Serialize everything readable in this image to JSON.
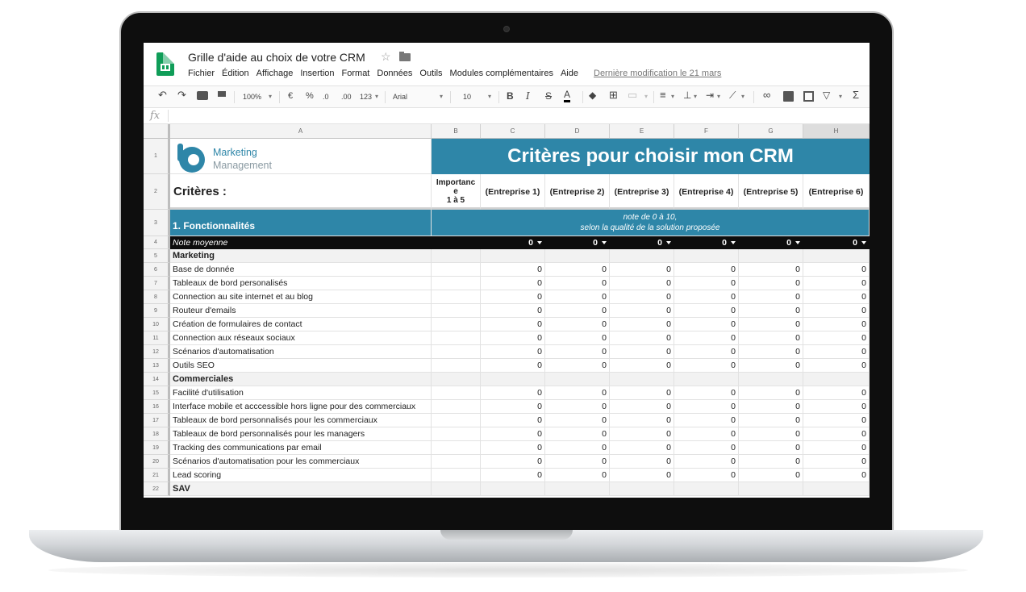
{
  "app": {
    "doc_title": "Grille d'aide au choix de votre CRM",
    "menu": [
      "Fichier",
      "Édition",
      "Affichage",
      "Insertion",
      "Format",
      "Données",
      "Outils",
      "Modules complémentaires",
      "Aide"
    ],
    "last_modified": "Dernière modification le 21 mars"
  },
  "toolbar": {
    "zoom": "100%",
    "currency": "€",
    "percent": "%",
    "dec_less": ".0",
    "dec_more": ".00",
    "format_123": "123",
    "font": "Arial",
    "font_size": "10",
    "bold": "B",
    "italic": "I",
    "strike": "S",
    "text_color": "A",
    "sum": "Σ"
  },
  "formula_bar": {
    "fx": "fx",
    "value": ""
  },
  "columns": [
    "A",
    "B",
    "C",
    "D",
    "E",
    "F",
    "G",
    "H"
  ],
  "sheet": {
    "logo_line1": "Marketing",
    "logo_line2": "Management",
    "banner_title": "Critères pour choisir mon CRM",
    "criteria_label": "Critères :",
    "importance_line1": "Importanc",
    "importance_line2": "e",
    "importance_line3": "1 à 5",
    "companies": [
      "(Entreprise 1)",
      "(Entreprise 2)",
      "(Entreprise 3)",
      "(Entreprise 4)",
      "(Entreprise 5)",
      "(Entreprise 6)"
    ],
    "section1_title": "1. Fonctionnalités",
    "note_line1": "note de 0 à 10,",
    "note_line2": "selon la qualité de la solution proposée",
    "avg_label": "Note moyenne",
    "avg_values": [
      "0",
      "0",
      "0",
      "0",
      "0",
      "0"
    ],
    "rows": [
      {
        "n": "5",
        "label": "Marketing",
        "section": true
      },
      {
        "n": "6",
        "label": "Base de donnée",
        "values": [
          "0",
          "0",
          "0",
          "0",
          "0",
          "0"
        ]
      },
      {
        "n": "7",
        "label": "Tableaux de bord personalisés",
        "values": [
          "0",
          "0",
          "0",
          "0",
          "0",
          "0"
        ]
      },
      {
        "n": "8",
        "label": "Connection au site internet et au blog",
        "values": [
          "0",
          "0",
          "0",
          "0",
          "0",
          "0"
        ]
      },
      {
        "n": "9",
        "label": "Routeur d'emails",
        "values": [
          "0",
          "0",
          "0",
          "0",
          "0",
          "0"
        ]
      },
      {
        "n": "10",
        "label": "Création de formulaires de contact",
        "values": [
          "0",
          "0",
          "0",
          "0",
          "0",
          "0"
        ]
      },
      {
        "n": "11",
        "label": "Connection aux réseaux sociaux",
        "values": [
          "0",
          "0",
          "0",
          "0",
          "0",
          "0"
        ]
      },
      {
        "n": "12",
        "label": "Scénarios d'automatisation",
        "values": [
          "0",
          "0",
          "0",
          "0",
          "0",
          "0"
        ]
      },
      {
        "n": "13",
        "label": "Outils SEO",
        "values": [
          "0",
          "0",
          "0",
          "0",
          "0",
          "0"
        ]
      },
      {
        "n": "14",
        "label": "Commerciales",
        "section": true
      },
      {
        "n": "15",
        "label": "Facilité d'utilisation",
        "values": [
          "0",
          "0",
          "0",
          "0",
          "0",
          "0"
        ]
      },
      {
        "n": "16",
        "label": "Interface mobile et acccessible hors ligne pour des commerciaux",
        "values": [
          "0",
          "0",
          "0",
          "0",
          "0",
          "0"
        ]
      },
      {
        "n": "17",
        "label": "Tableaux de bord personnalisés pour les commerciaux",
        "values": [
          "0",
          "0",
          "0",
          "0",
          "0",
          "0"
        ]
      },
      {
        "n": "18",
        "label": "Tableaux de bord personnalisés pour les managers",
        "values": [
          "0",
          "0",
          "0",
          "0",
          "0",
          "0"
        ]
      },
      {
        "n": "19",
        "label": "Tracking des communications par email",
        "values": [
          "0",
          "0",
          "0",
          "0",
          "0",
          "0"
        ]
      },
      {
        "n": "20",
        "label": "Scénarios d'automatisation pour les commerciaux",
        "values": [
          "0",
          "0",
          "0",
          "0",
          "0",
          "0"
        ]
      },
      {
        "n": "21",
        "label": "Lead scoring",
        "values": [
          "0",
          "0",
          "0",
          "0",
          "0",
          "0"
        ]
      },
      {
        "n": "22",
        "label": "SAV",
        "section": true
      }
    ]
  },
  "colors": {
    "teal": "#2e86a8",
    "sheets_green": "#0f9d58"
  }
}
